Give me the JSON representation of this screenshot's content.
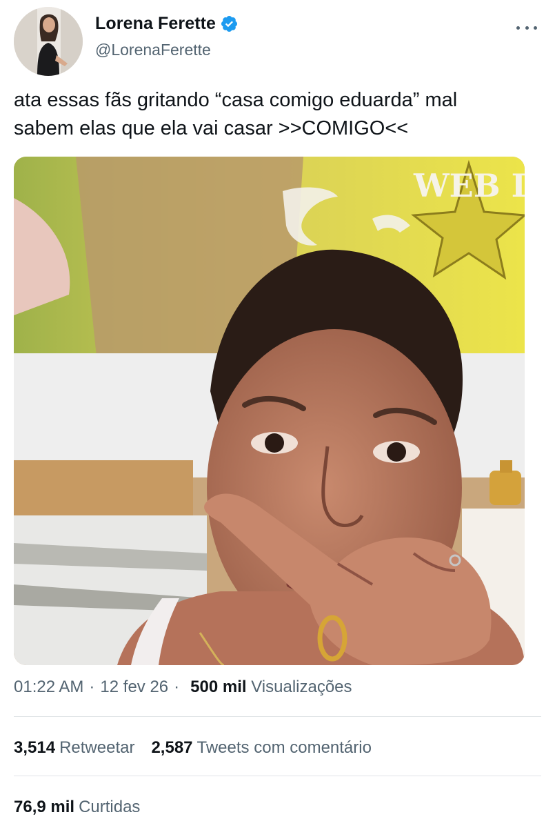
{
  "author": {
    "display_name": "Lorena Ferette",
    "handle": "@LorenaFerette",
    "verified": true
  },
  "tweet": {
    "text": "ata essas fãs gritando “casa comigo eduarda” mal\nsabem elas que ela vai casar >>COMIGO<<",
    "media_label": "WEB D"
  },
  "meta": {
    "time": "01:22 AM",
    "date": "12 fev 26",
    "views_count": "500 mil",
    "views_label": "Visualizações"
  },
  "stats": {
    "retweets_count": "3,514",
    "retweets_label": "Retweetar",
    "quotes_count": "2,587",
    "quotes_label": "Tweets com comentário",
    "likes_count": "76,9 mil",
    "likes_label": "Curtidas"
  },
  "icons": {
    "verified": "verified-badge-icon",
    "more": "more-options-icon"
  },
  "colors": {
    "verified_blue": "#1d9bf0",
    "secondary_text": "#536471",
    "primary_text": "#0f1419"
  }
}
